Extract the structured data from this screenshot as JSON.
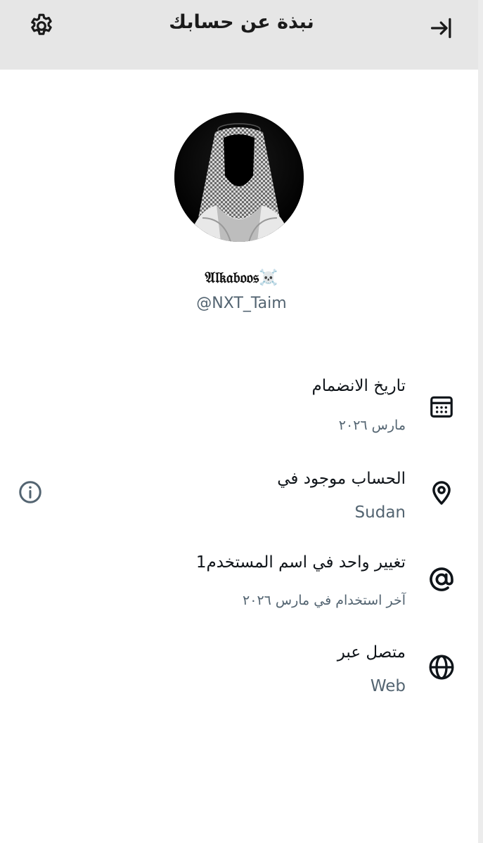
{
  "header": {
    "title": "نبذة عن حسابك",
    "settings_icon": "gear-icon",
    "back_icon": "exit-arrow-icon"
  },
  "profile": {
    "display_name": "𝔄𝔩𝔨𝔞𝔟𝔬𝔬𝔰☠️",
    "handle": "@NXT_Taim"
  },
  "details": [
    {
      "icon": "calendar-icon",
      "title": "تاريخ الانضمام",
      "value": "مارس ٢٠٢٦"
    },
    {
      "icon": "location-pin-icon",
      "title": "الحساب موجود في",
      "value": "Sudan"
    },
    {
      "icon": "at-sign-icon",
      "title": "تغيير واحد في اسم المستخدم1",
      "value": "آخر استخدام في مارس ٢٠٢٦"
    },
    {
      "icon": "globe-icon",
      "title": "متصل عبر",
      "value": "Web"
    }
  ],
  "info_icon": "info-icon"
}
